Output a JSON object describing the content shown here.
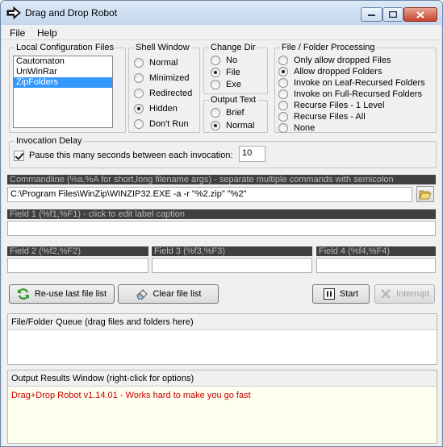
{
  "window": {
    "title": "Drag and Drop Robot"
  },
  "menu": {
    "file": "File",
    "help": "Help"
  },
  "configs": {
    "label": "Local Configuration Files",
    "items": [
      {
        "label": "Cautomaton"
      },
      {
        "label": "UnWinRar"
      },
      {
        "label": "ZipFolders"
      }
    ],
    "selected": "ZipFolders"
  },
  "shell_window": {
    "label": "Shell Window",
    "options": [
      "Normal",
      "Minimized",
      "Redirected",
      "Hidden",
      "Don't Run"
    ],
    "selected": "Hidden"
  },
  "change_dir": {
    "label": "Change Dir",
    "options": [
      "No",
      "File",
      "Exe"
    ],
    "selected": "File"
  },
  "output_text": {
    "label": "Output Text",
    "options": [
      "Brief",
      "Normal"
    ],
    "selected": "Normal"
  },
  "processing": {
    "label": "File / Folder Processing",
    "options": [
      "Only allow dropped Files",
      "Allow dropped Folders",
      "Invoke on Leaf-Recursed Folders",
      "Invoke on Full-Recursed Folders",
      "Recurse Files - 1 Level",
      "Recurse Files - All",
      "None"
    ],
    "selected": "Allow dropped Folders"
  },
  "delay": {
    "label": "Invocation Delay",
    "checkbox_label": "Pause this many seconds between each invocation:",
    "checked": true,
    "value": "10"
  },
  "commandline": {
    "label": "Commandline (%a,%A for short,long filename args) - separate multiple commands with semicolon",
    "value": "C:\\Program Files\\WinZip\\WINZIP32.EXE -a -r \"%2.zip\" \"%2\""
  },
  "fields": {
    "field1_label": "Field 1 (%f1,%F1) - click to edit label caption",
    "field1_value": "",
    "field2_label": "Field 2 (%f2,%F2)",
    "field2_value": "",
    "field3_label": "Field 3 (%f3,%F3)",
    "field3_value": "",
    "field4_label": "Field 4 (%f4,%F4)",
    "field4_value": ""
  },
  "buttons": {
    "reuse": "Re-use last file list",
    "clear": "Clear file list",
    "start": "Start",
    "interrupt": "Interrupt"
  },
  "queue": {
    "label": "File/Folder Queue (drag files and folders here)"
  },
  "output": {
    "label": "Output Results Window (right-click for options)",
    "message": "Drag+Drop Robot v1.14.01 - Works hard to make you go fast",
    "message_color": "#cc0000",
    "background": "#fffff0"
  }
}
